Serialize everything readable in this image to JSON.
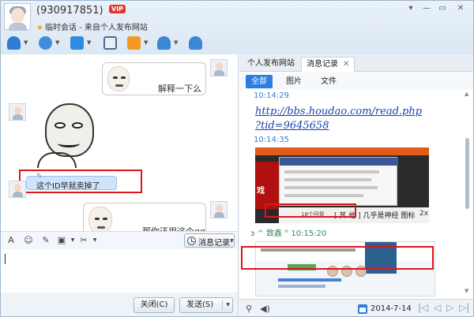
{
  "header": {
    "contact_id": "(930917851)",
    "vip_badge": "VIP",
    "subtitle": "临时会话 - 来自个人发布网站",
    "window_controls": [
      "▾",
      "—",
      "▭",
      "✕"
    ]
  },
  "chat": {
    "messages": [
      {
        "text": "解释一下么"
      },
      {
        "text": "这个ID早就卖掉了"
      },
      {
        "text": "那你还用这个qq"
      }
    ]
  },
  "input_toolbar": {
    "font_icon": "A",
    "emoji_icon": "☺",
    "history_label": "消息记录"
  },
  "bottom_buttons": {
    "close_label": "关闭(C)",
    "send_label": "发送(S)"
  },
  "right_panel": {
    "tabs": [
      {
        "label": "个人发布网站"
      },
      {
        "label": "消息记录"
      }
    ],
    "filters": [
      {
        "label": "全部"
      },
      {
        "label": "图片"
      },
      {
        "label": "文件"
      }
    ],
    "log": {
      "time1": "10:14:29",
      "link_line1": "http://bbs.houdao.com/read.php",
      "link_line2": "?tid=9645658",
      "time2": "10:14:35",
      "shot1_caption": "[ 其 他 ] 几乎是神经 图标",
      "shot1_tab": "18个回复",
      "sender": "ɜ ^ 致鑫 ° 10:15:20",
      "zoom": "2x"
    },
    "status": {
      "date": "2014-7-14"
    }
  },
  "colors": {
    "accent": "#2a7de1",
    "highlight_red": "#e0141a",
    "link_blue": "#1a3eb0",
    "sender_green": "#2e8b57"
  }
}
